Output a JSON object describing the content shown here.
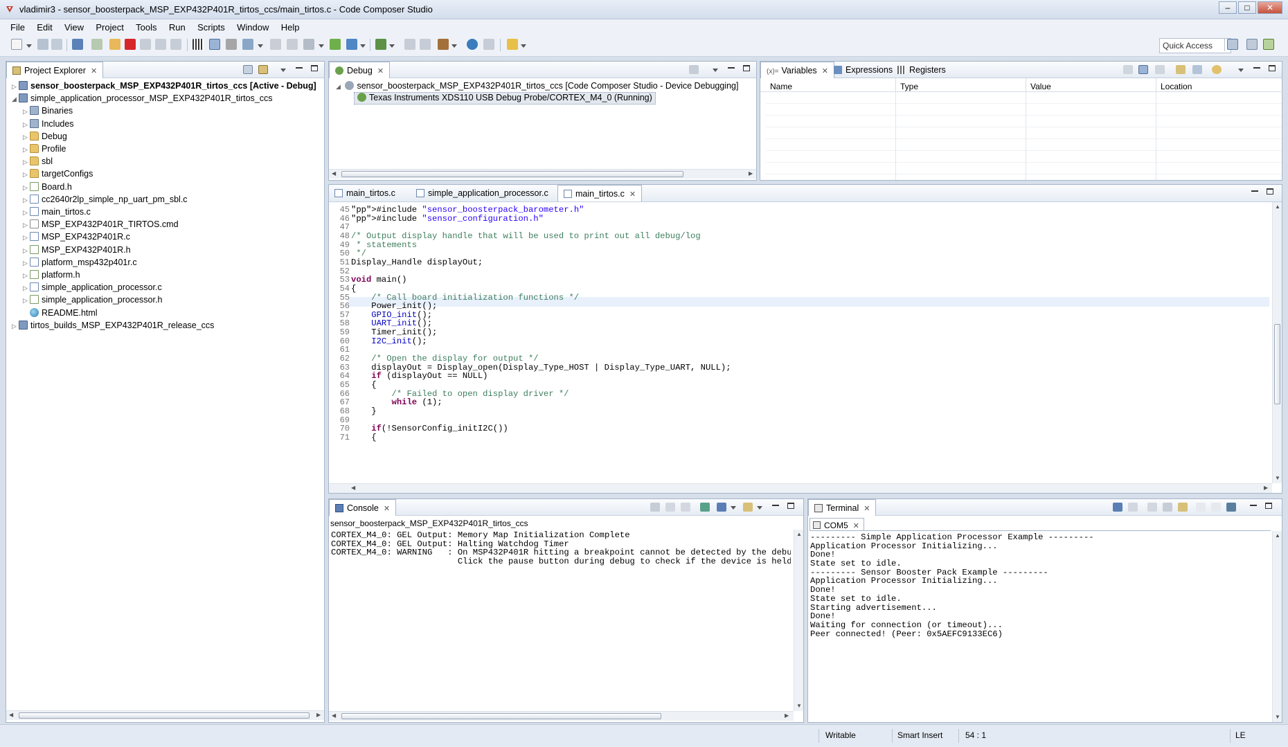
{
  "window": {
    "title": "vladimir3 - sensor_boosterpack_MSP_EXP432P401R_tirtos_ccs/main_tirtos.c - Code Composer Studio",
    "minimize": "–",
    "maximize": "□",
    "close": "✕"
  },
  "menu": [
    "File",
    "Edit",
    "View",
    "Project",
    "Tools",
    "Run",
    "Scripts",
    "Window",
    "Help"
  ],
  "toolbar": {
    "quick_access": "Quick Access"
  },
  "project_explorer": {
    "tab_label": "Project Explorer",
    "rows": [
      {
        "label": "sensor_boosterpack_MSP_EXP432P401R_tirtos_ccs  [Active - Debug]",
        "icon": "project-icon",
        "bold": true
      },
      {
        "label": "simple_application_processor_MSP_EXP432P401R_tirtos_ccs",
        "icon": "project-icon"
      },
      {
        "label": "Binaries",
        "icon": "binaries-icon"
      },
      {
        "label": "Includes",
        "icon": "includes-icon"
      },
      {
        "label": "Debug",
        "icon": "folder-icon"
      },
      {
        "label": "Profile",
        "icon": "folder-icon"
      },
      {
        "label": "sbl",
        "icon": "folder-icon"
      },
      {
        "label": "targetConfigs",
        "icon": "folder-icon"
      },
      {
        "label": "Board.h",
        "icon": "h-file-icon"
      },
      {
        "label": "cc2640r2lp_simple_np_uart_pm_sbl.c",
        "icon": "c-file-icon"
      },
      {
        "label": "main_tirtos.c",
        "icon": "c-file-icon"
      },
      {
        "label": "MSP_EXP432P401R_TIRTOS.cmd",
        "icon": "cmd-file-icon"
      },
      {
        "label": "MSP_EXP432P401R.c",
        "icon": "c-file-icon"
      },
      {
        "label": "MSP_EXP432P401R.h",
        "icon": "h-file-icon"
      },
      {
        "label": "platform_msp432p401r.c",
        "icon": "c-file-icon"
      },
      {
        "label": "platform.h",
        "icon": "h-file-icon"
      },
      {
        "label": "simple_application_processor.c",
        "icon": "c-file-icon"
      },
      {
        "label": "simple_application_processor.h",
        "icon": "h-file-icon"
      },
      {
        "label": "README.html",
        "icon": "html-file-icon"
      },
      {
        "label": "tirtos_builds_MSP_EXP432P401R_release_ccs",
        "icon": "project-icon"
      }
    ]
  },
  "debug": {
    "tab_label": "Debug",
    "session": "sensor_boosterpack_MSP_EXP432P401R_tirtos_ccs [Code Composer Studio - Device Debugging]",
    "target": "Texas Instruments XDS110 USB Debug Probe/CORTEX_M4_0 (Running)"
  },
  "variables": {
    "tabs": [
      "Variables",
      "Expressions",
      "Registers"
    ],
    "columns": [
      "Name",
      "Type",
      "Value",
      "Location"
    ]
  },
  "editor": {
    "tabs": [
      "main_tirtos.c",
      "simple_application_processor.c",
      "main_tirtos.c"
    ],
    "lines": [
      {
        "n": "45",
        "t": "#include \"sensor_boosterpack_barometer.h\""
      },
      {
        "n": "46",
        "t": "#include \"sensor_configuration.h\""
      },
      {
        "n": "47",
        "t": ""
      },
      {
        "n": "48",
        "t": "/* Output display handle that will be used to print out all debug/log"
      },
      {
        "n": "49",
        "t": " * statements"
      },
      {
        "n": "50",
        "t": " */"
      },
      {
        "n": "51",
        "t": "Display_Handle displayOut;"
      },
      {
        "n": "52",
        "t": ""
      },
      {
        "n": "53",
        "t": "void main()"
      },
      {
        "n": "54",
        "t": "{"
      },
      {
        "n": "55",
        "t": "    /* Call board initialization functions */"
      },
      {
        "n": "56",
        "t": "    Power_init();"
      },
      {
        "n": "57",
        "t": "    GPIO_init();"
      },
      {
        "n": "58",
        "t": "    UART_init();"
      },
      {
        "n": "59",
        "t": "    Timer_init();"
      },
      {
        "n": "60",
        "t": "    I2C_init();"
      },
      {
        "n": "61",
        "t": ""
      },
      {
        "n": "62",
        "t": "    /* Open the display for output */"
      },
      {
        "n": "63",
        "t": "    displayOut = Display_open(Display_Type_HOST | Display_Type_UART, NULL);"
      },
      {
        "n": "64",
        "t": "    if (displayOut == NULL)"
      },
      {
        "n": "65",
        "t": "    {"
      },
      {
        "n": "66",
        "t": "        /* Failed to open display driver */"
      },
      {
        "n": "67",
        "t": "        while (1);"
      },
      {
        "n": "68",
        "t": "    }"
      },
      {
        "n": "69",
        "t": ""
      },
      {
        "n": "70",
        "t": "    if(!SensorConfig_initI2C())"
      },
      {
        "n": "71",
        "t": "    {"
      }
    ]
  },
  "console": {
    "tab_label": "Console",
    "subtitle": "sensor_boosterpack_MSP_EXP432P401R_tirtos_ccs",
    "lines": [
      "CORTEX_M4_0: GEL Output: Memory Map Initialization Complete",
      "CORTEX_M4_0: GEL Output: Halting Watchdog Timer",
      "CORTEX_M4_0: WARNING   : On MSP432P401R hitting a breakpoint cannot be detected by the debugger",
      "                         Click the pause button during debug to check if the device is held at"
    ]
  },
  "terminal": {
    "tab_label": "Terminal",
    "sub_tab": "COM5",
    "lines": [
      "--------- Simple Application Processor Example ---------",
      "Application Processor Initializing...",
      "Done!",
      "State set to idle.",
      "--------- Sensor Booster Pack Example ---------",
      "Application Processor Initializing...",
      "Done!",
      "State set to idle.",
      "Starting advertisement...",
      "Done!",
      "Waiting for connection (or timeout)...",
      "Peer connected! (Peer: 0x5AEFC9133EC6)"
    ]
  },
  "status": {
    "writable": "Writable",
    "insert_mode": "Smart Insert",
    "position": "54 : 1",
    "endian": "LE"
  }
}
